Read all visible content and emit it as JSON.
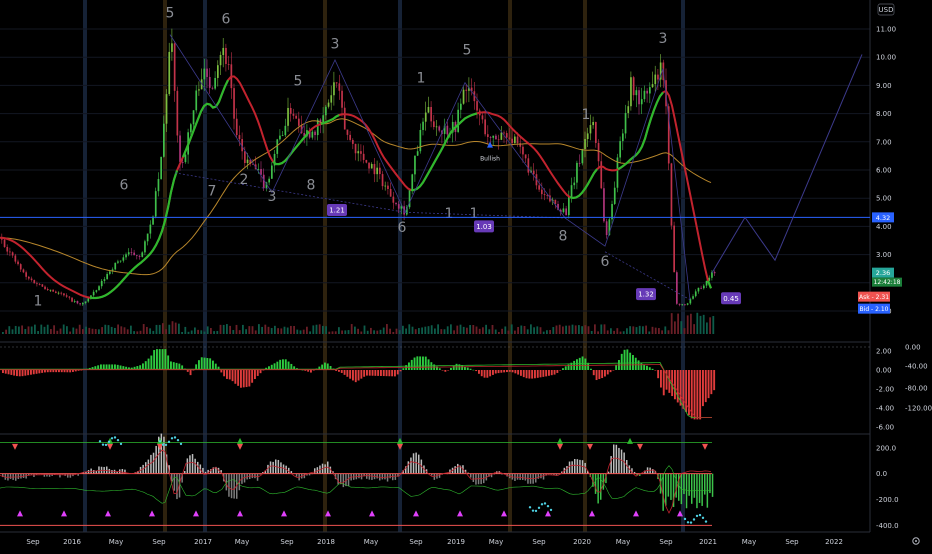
{
  "chart_data": {
    "type": "candlestick",
    "currency": "USD",
    "x_ticks": [
      "Sep",
      "2016",
      "May",
      "Sep",
      "2017",
      "May",
      "Sep",
      "2018",
      "May",
      "Sep",
      "2019",
      "May",
      "Sep",
      "2020",
      "May",
      "Sep",
      "2021",
      "May",
      "Sep",
      "2022"
    ],
    "price_ticks": [
      "11.00",
      "10.00",
      "9.00",
      "8.00",
      "7.00",
      "6.00",
      "5.00",
      "4.00",
      "3.00",
      "2.00",
      "1.00"
    ],
    "price_ylim": [
      0.7,
      11.5
    ],
    "close_series": [
      [
        0,
        3.6
      ],
      [
        10,
        3.0
      ],
      [
        25,
        2.2
      ],
      [
        40,
        1.9
      ],
      [
        60,
        1.6
      ],
      [
        80,
        1.2
      ],
      [
        95,
        1.7
      ],
      [
        110,
        2.5
      ],
      [
        125,
        3.0
      ],
      [
        140,
        3.0
      ],
      [
        150,
        4.0
      ],
      [
        160,
        6.2
      ],
      [
        165,
        8.5
      ],
      [
        170,
        10.8
      ],
      [
        175,
        8.0
      ],
      [
        180,
        6.0
      ],
      [
        190,
        7.6
      ],
      [
        200,
        9.5
      ],
      [
        210,
        9.0
      ],
      [
        220,
        10.3
      ],
      [
        228,
        9.8
      ],
      [
        235,
        7.2
      ],
      [
        245,
        6.3
      ],
      [
        255,
        6.0
      ],
      [
        265,
        5.4
      ],
      [
        275,
        6.8
      ],
      [
        290,
        8.2
      ],
      [
        305,
        7.3
      ],
      [
        320,
        7.6
      ],
      [
        335,
        9.2
      ],
      [
        345,
        7.3
      ],
      [
        360,
        6.5
      ],
      [
        375,
        6.0
      ],
      [
        390,
        5.1
      ],
      [
        405,
        4.5
      ],
      [
        415,
        6.5
      ],
      [
        425,
        8.1
      ],
      [
        440,
        7.4
      ],
      [
        455,
        7.6
      ],
      [
        465,
        9.1
      ],
      [
        475,
        8.2
      ],
      [
        490,
        7.0
      ],
      [
        505,
        7.4
      ],
      [
        515,
        6.9
      ],
      [
        525,
        6.3
      ],
      [
        540,
        5.1
      ],
      [
        555,
        4.8
      ],
      [
        565,
        4.5
      ],
      [
        575,
        5.9
      ],
      [
        585,
        7.2
      ],
      [
        592,
        7.8
      ],
      [
        598,
        6.3
      ],
      [
        605,
        3.5
      ],
      [
        612,
        5.0
      ],
      [
        620,
        7.2
      ],
      [
        630,
        9.0
      ],
      [
        640,
        8.4
      ],
      [
        650,
        8.9
      ],
      [
        660,
        9.5
      ],
      [
        665,
        8.5
      ],
      [
        670,
        4.3
      ],
      [
        675,
        1.3
      ],
      [
        685,
        1.2
      ],
      [
        695,
        1.7
      ],
      [
        705,
        2.0
      ],
      [
        712,
        2.4
      ]
    ],
    "projection_path": [
      [
        712,
        2.35
      ],
      [
        745,
        4.32
      ],
      [
        775,
        2.8
      ],
      [
        862,
        10.1
      ]
    ],
    "annotations": {
      "horizontal_level": "4.32",
      "last_price": "2.36",
      "countdown": "12:42:18",
      "ask": "Ask - 2.31",
      "bid": "Bid - 2.10",
      "fib_labels": [
        "1.21",
        "1.03",
        "1.32",
        "0.45"
      ],
      "bullish_label": "Bullish",
      "wave_labels": [
        "1",
        "6",
        "5",
        "6",
        "7",
        "2",
        "3",
        "5",
        "8",
        "3",
        "6",
        "1",
        "1",
        "5",
        "1",
        "8",
        "1",
        "6",
        "3"
      ]
    },
    "macd_ticks": [
      "2.00",
      "0.00",
      "-2.00",
      "-4.00",
      "-6.00"
    ],
    "macd_ylim": [
      -6,
      2.5
    ],
    "macd_right_ticks": [
      "0.00",
      "-40.00",
      "-80.00",
      "-120.00"
    ],
    "osc_ticks": [
      "200.0",
      "0.0",
      "-200.0",
      "-400.0"
    ],
    "osc_ylim": [
      -420,
      260
    ]
  }
}
